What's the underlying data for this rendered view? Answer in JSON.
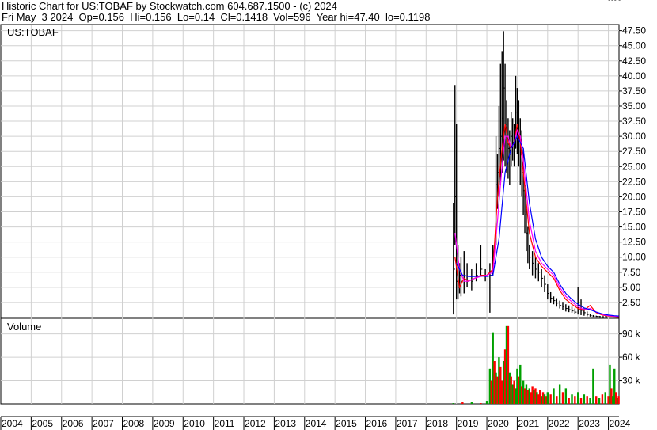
{
  "header": {
    "line1": "Historic Chart for US:TOBAF by Stockwatch.com 604.687.1500 - (c) 2024",
    "line2": "Fri May  3 2024  Op=0.156  Hi=0.156  Lo=0.14  Cl=0.1418  Vol=596  Year hi=47.40  lo=0.1198"
  },
  "colors": {
    "price_bar": "#000000",
    "ma_short": "#ff0000",
    "ma_mid": "#ff00ff",
    "ma_long": "#0000ff",
    "volume_up": "#00a000",
    "volume_down": "#ff0000",
    "grid": "#d0d0d0"
  },
  "chart_data": [
    {
      "type": "line",
      "title": "US:TOBAF",
      "y_ticks": [
        "2.50",
        "5.00",
        "7.50",
        "10.00",
        "12.50",
        "15.00",
        "17.50",
        "20.00",
        "22.50",
        "25.00",
        "27.50",
        "30.00",
        "32.50",
        "35.00",
        "37.50",
        "40.00",
        "42.50",
        "45.00",
        "47.50"
      ],
      "ylim": [
        0,
        48.5
      ],
      "x_ticks": [
        "2004",
        "2005",
        "2006",
        "2007",
        "2008",
        "2009",
        "2010",
        "2011",
        "2012",
        "2013",
        "2014",
        "2015",
        "2016",
        "2017",
        "2018",
        "2019",
        "2020",
        "2021",
        "2022",
        "2023",
        "2024"
      ],
      "xlim": [
        2004.0,
        2024.35
      ],
      "grid": true,
      "series": [
        {
          "kind": "price",
          "x": [
            2018.9,
            2018.95,
            2019.0,
            2019.05,
            2019.1,
            2019.15,
            2019.25,
            2019.35,
            2019.5,
            2019.65,
            2019.8,
            2019.95,
            2020.1,
            2020.2,
            2020.3,
            2020.35,
            2020.4,
            2020.45,
            2020.5,
            2020.55,
            2020.6,
            2020.65,
            2020.7,
            2020.75,
            2020.8,
            2020.85,
            2020.9,
            2020.95,
            2021.0,
            2021.05,
            2021.1,
            2021.15,
            2021.2,
            2021.25,
            2021.3,
            2021.35,
            2021.4,
            2021.5,
            2021.6,
            2021.7,
            2021.8,
            2021.9,
            2022.0,
            2022.1,
            2022.2,
            2022.3,
            2022.4,
            2022.5,
            2022.6,
            2022.7,
            2022.8,
            2022.9,
            2023.0,
            2023.1,
            2023.2,
            2023.3,
            2023.4,
            2023.5,
            2023.6,
            2023.7,
            2023.8,
            2023.9,
            2024.0,
            2024.1,
            2024.2,
            2024.34
          ],
          "high": [
            19,
            38.5,
            32,
            12,
            9,
            10,
            11,
            9,
            8,
            9,
            12,
            8,
            9,
            12,
            30,
            27,
            35,
            42,
            44,
            47.4,
            42,
            36,
            33,
            31,
            34,
            33,
            32,
            40,
            38,
            36,
            33,
            31,
            28,
            22,
            18,
            15,
            12,
            11,
            10,
            9,
            8,
            7,
            5.5,
            4.2,
            3.5,
            3.2,
            2.8,
            2.6,
            2.2,
            2.0,
            1.8,
            1.5,
            5.0,
            3.0,
            1.5,
            1.0,
            0.6,
            0.4,
            0.3,
            0.25,
            0.2,
            0.2
          ],
          "low": [
            0.5,
            12,
            3,
            3,
            4,
            3.5,
            4,
            5,
            4.5,
            6,
            7,
            6,
            0.8,
            7,
            12,
            18,
            20,
            22,
            24,
            26,
            25,
            24,
            23,
            22,
            25,
            26,
            25,
            28,
            27,
            25,
            22,
            20,
            17,
            14,
            11,
            9,
            8,
            7,
            6.5,
            6,
            5,
            4.2,
            3,
            2.5,
            2.2,
            1.8,
            1.5,
            1.3,
            1.0,
            0.9,
            0.8,
            0.6,
            0.5,
            0.4,
            0.3,
            0.2,
            0.15,
            0.12,
            0.12,
            0.12,
            0.12,
            0.12
          ],
          "close": [
            8,
            20,
            6,
            5,
            7,
            6,
            7,
            6,
            6,
            7,
            8,
            7,
            7,
            9,
            22,
            24,
            28,
            30,
            33,
            38,
            32,
            30,
            28,
            27,
            30,
            29,
            28,
            34,
            32,
            30,
            27,
            24,
            21,
            17,
            14,
            12,
            10,
            9,
            8,
            7.5,
            6.5,
            5.5,
            4,
            3.2,
            2.8,
            2.4,
            2.0,
            1.8,
            1.5,
            1.3,
            1.1,
            0.9,
            2.5,
            1.2,
            0.8,
            0.5,
            0.3,
            0.22,
            0.18,
            0.16,
            0.15,
            0.14
          ]
        },
        {
          "kind": "ma",
          "color_key": "ma_short",
          "x": [
            2018.95,
            2019.1,
            2019.25,
            2019.4,
            2019.6,
            2019.8,
            2020.0,
            2020.2,
            2020.35,
            2020.5,
            2020.6,
            2020.7,
            2020.8,
            2020.9,
            2021.0,
            2021.1,
            2021.2,
            2021.3,
            2021.4,
            2021.6,
            2021.8,
            2022.0,
            2022.2,
            2022.4,
            2022.6,
            2022.8,
            2023.0,
            2023.2,
            2023.4,
            2023.6,
            2023.8,
            2024.0,
            2024.2,
            2024.34
          ],
          "y": [
            10,
            5,
            6.5,
            6,
            6.5,
            7,
            7,
            8,
            20,
            28,
            32,
            29,
            28,
            29,
            32,
            29,
            24,
            19,
            14,
            10,
            8.5,
            7.5,
            6.5,
            4.5,
            3.0,
            2.2,
            1.5,
            1.2,
            2.0,
            0.8,
            0.4,
            0.25,
            0.2,
            0.15
          ]
        },
        {
          "kind": "ma",
          "color_key": "ma_mid",
          "x": [
            2018.95,
            2019.1,
            2019.25,
            2019.4,
            2019.6,
            2019.8,
            2020.0,
            2020.2,
            2020.35,
            2020.5,
            2020.6,
            2020.7,
            2020.8,
            2020.9,
            2021.0,
            2021.1,
            2021.2,
            2021.3,
            2021.4,
            2021.6,
            2021.8,
            2022.0,
            2022.2,
            2022.4,
            2022.6,
            2022.8,
            2023.0,
            2023.2,
            2023.4,
            2023.6,
            2023.8,
            2024.0,
            2024.2,
            2024.34
          ],
          "y": [
            14,
            8,
            6,
            6,
            6.5,
            6.8,
            7,
            7.5,
            16,
            25,
            30,
            30,
            28,
            29,
            31,
            30,
            26,
            21,
            16,
            11,
            9,
            8,
            7,
            5,
            3.5,
            2.6,
            1.8,
            1.3,
            1.5,
            0.9,
            0.5,
            0.3,
            0.22,
            0.17
          ]
        },
        {
          "kind": "ma",
          "color_key": "ma_long",
          "x": [
            2019.0,
            2019.2,
            2019.4,
            2019.6,
            2019.8,
            2020.0,
            2020.2,
            2020.4,
            2020.6,
            2020.8,
            2021.0,
            2021.2,
            2021.4,
            2021.6,
            2021.8,
            2022.0,
            2022.2,
            2022.4,
            2022.6,
            2022.8,
            2023.0,
            2023.2,
            2023.4,
            2023.6,
            2023.8,
            2024.0,
            2024.2,
            2024.34
          ],
          "y": [
            9,
            7,
            6.8,
            6.8,
            6.9,
            6.8,
            7,
            13,
            24,
            28,
            30,
            28,
            19,
            13,
            10,
            8.5,
            7.5,
            5.5,
            4.0,
            3.0,
            2.2,
            1.6,
            1.3,
            0.9,
            0.6,
            0.4,
            0.3,
            0.25
          ]
        }
      ]
    },
    {
      "type": "bar",
      "title": "Volume",
      "y_ticks": [
        "30 k",
        "60 k",
        "90 k"
      ],
      "ylim": [
        0,
        110
      ],
      "x": [
        2018.9,
        2019.2,
        2019.5,
        2019.8,
        2020.0,
        2020.1,
        2020.15,
        2020.2,
        2020.25,
        2020.3,
        2020.35,
        2020.4,
        2020.45,
        2020.5,
        2020.55,
        2020.6,
        2020.65,
        2020.7,
        2020.75,
        2020.8,
        2020.85,
        2020.9,
        2020.95,
        2021.0,
        2021.05,
        2021.1,
        2021.15,
        2021.2,
        2021.25,
        2021.3,
        2021.35,
        2021.4,
        2021.45,
        2021.5,
        2021.55,
        2021.6,
        2021.65,
        2021.7,
        2021.75,
        2021.8,
        2021.85,
        2021.9,
        2021.95,
        2022.0,
        2022.1,
        2022.2,
        2022.3,
        2022.4,
        2022.5,
        2022.6,
        2022.7,
        2022.8,
        2022.9,
        2023.0,
        2023.1,
        2023.2,
        2023.3,
        2023.4,
        2023.5,
        2023.6,
        2023.7,
        2023.8,
        2023.9,
        2024.0,
        2024.05,
        2024.1,
        2024.15,
        2024.2,
        2024.25,
        2024.3,
        2024.34
      ],
      "values": [
        1,
        2,
        2,
        1,
        3,
        45,
        30,
        92,
        55,
        40,
        35,
        60,
        48,
        30,
        55,
        70,
        100,
        100,
        40,
        35,
        25,
        30,
        20,
        45,
        35,
        50,
        22,
        30,
        20,
        25,
        18,
        20,
        15,
        22,
        18,
        20,
        15,
        12,
        18,
        10,
        15,
        12,
        10,
        15,
        12,
        20,
        10,
        25,
        15,
        20,
        8,
        12,
        10,
        15,
        8,
        12,
        10,
        8,
        45,
        10,
        8,
        12,
        15,
        10,
        50,
        20,
        10,
        45,
        15,
        8,
        10
      ],
      "up": [
        true,
        false,
        true,
        false,
        true,
        true,
        false,
        true,
        false,
        true,
        false,
        true,
        false,
        false,
        true,
        false,
        true,
        false,
        true,
        false,
        true,
        false,
        true,
        true,
        false,
        true,
        false,
        true,
        false,
        true,
        false,
        true,
        false,
        false,
        true,
        false,
        true,
        false,
        false,
        true,
        false,
        true,
        false,
        true,
        false,
        true,
        false,
        true,
        false,
        true,
        false,
        true,
        false,
        true,
        false,
        true,
        false,
        true,
        true,
        false,
        true,
        false,
        true,
        false,
        true,
        false,
        true,
        true,
        false,
        true,
        false
      ]
    }
  ]
}
